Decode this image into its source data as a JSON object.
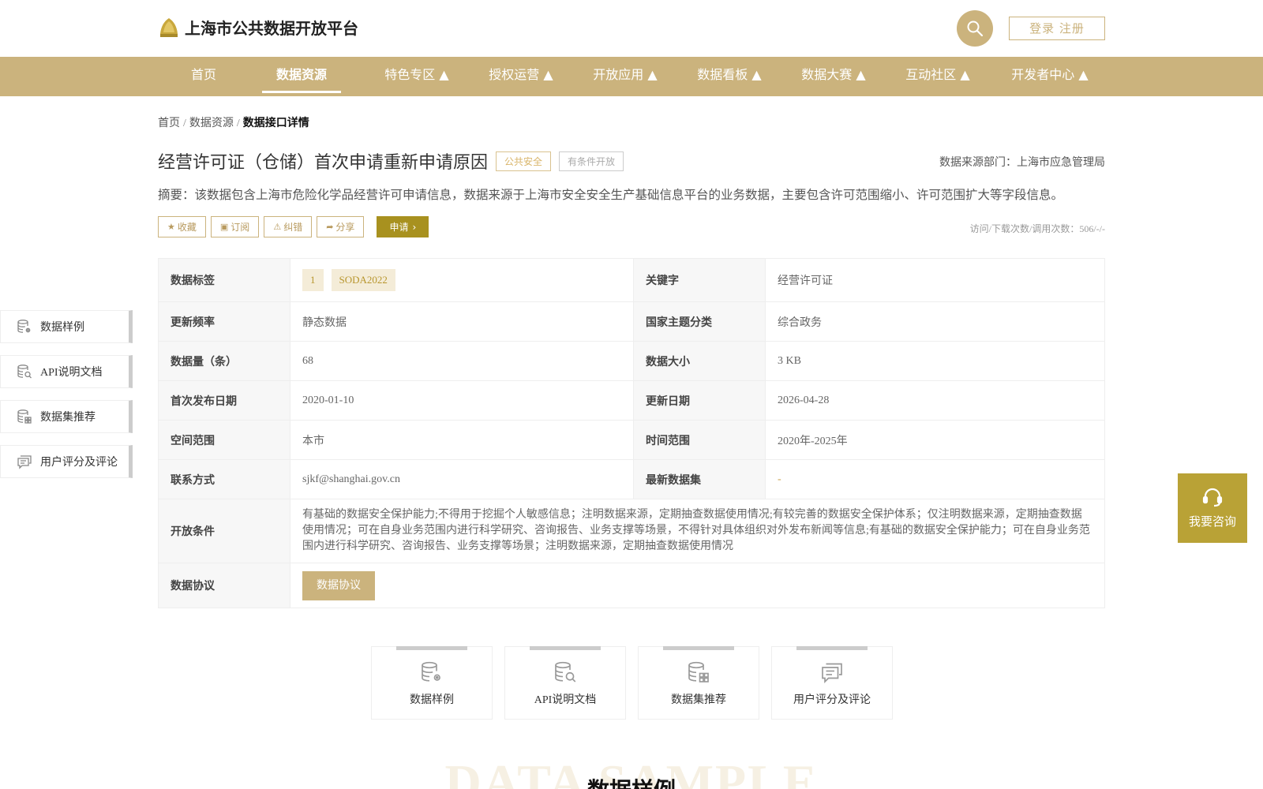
{
  "header": {
    "site_title": "上海市公共数据开放平台",
    "login_label": "登录 注册"
  },
  "nav": {
    "items": [
      {
        "label": "首页"
      },
      {
        "label": "数据资源"
      },
      {
        "label": "特色专区 ▲"
      },
      {
        "label": "授权运营 ▲"
      },
      {
        "label": "开放应用 ▲"
      },
      {
        "label": "数据看板 ▲"
      },
      {
        "label": "数据大赛 ▲"
      },
      {
        "label": "互动社区 ▲"
      },
      {
        "label": "开发者中心 ▲"
      }
    ]
  },
  "breadcrumb": {
    "items": [
      "首页",
      "数据资源",
      "数据接口详情"
    ],
    "separator": "/"
  },
  "dataset": {
    "title": "经营许可证（仓储）首次申请重新申请原因",
    "badge_category": "公共安全",
    "badge_openness": "有条件开放",
    "source_dept": "数据来源部门：上海市应急管理局",
    "summary": "摘要：该数据包含上海市危险化学品经营许可申请信息，数据来源于上海市安全安全生产基础信息平台的业务数据，主要包含许可范围缩小、许可范围扩大等字段信息。",
    "stats": "访问/下载次数/调用次数：506/-/-"
  },
  "actions": {
    "favorite": "收藏",
    "subscribe": "订阅",
    "correct": "纠错",
    "share": "分享",
    "apply": "申请"
  },
  "table": {
    "tags_label": "数据标签",
    "tags": [
      "1",
      "SODA2022"
    ],
    "keyword_label": "关键字",
    "keyword": "经营许可证",
    "freq_label": "更新频率",
    "freq": "静态数据",
    "theme_label": "国家主题分类",
    "theme": "综合政务",
    "count_label": "数据量（条）",
    "count": "68",
    "size_label": "数据大小",
    "size": "3 KB",
    "first_pub_label": "首次发布日期",
    "first_pub": "2020-01-10",
    "updated_label": "更新日期",
    "updated": "2026-04-28",
    "space_label": "空间范围",
    "space": "本市",
    "time_label": "时间范围",
    "time": "2020年-2025年",
    "contact_label": "联系方式",
    "contact": "sjkf@shanghai.gov.cn",
    "latest_label": "最新数据集",
    "latest": "-",
    "conditions_label": "开放条件",
    "conditions": "有基础的数据安全保护能力;不得用于挖掘个人敏感信息；注明数据来源，定期抽查数据使用情况;有较完善的数据安全保护体系；仅注明数据来源，定期抽查数据使用情况；可在自身业务范围内进行科学研究、咨询报告、业务支撑等场景，不得针对具体组织对外发布新闻等信息;有基础的数据安全保护能力；可在自身业务范围内进行科学研究、咨询报告、业务支撑等场景；注明数据来源，定期抽查数据使用情况",
    "protocol_label": "数据协议",
    "protocol_button": "数据协议"
  },
  "side_nav": {
    "items": [
      {
        "label": "数据样例",
        "icon": "database-gear-icon"
      },
      {
        "label": "API说明文档",
        "icon": "database-search-icon"
      },
      {
        "label": "数据集推荐",
        "icon": "database-grid-icon"
      },
      {
        "label": "用户评分及评论",
        "icon": "comment-icon"
      }
    ]
  },
  "consult": {
    "label": "我要咨询"
  },
  "bottom_tabs": {
    "items": [
      {
        "label": "数据样例"
      },
      {
        "label": "API说明文档"
      },
      {
        "label": "数据集推荐"
      },
      {
        "label": "用户评分及评论"
      }
    ]
  },
  "section": {
    "watermark": "DATA SAMPLE",
    "title": "数据样例"
  },
  "colors": {
    "brand": "#cbb37d",
    "apply": "#a8911f",
    "consult": "#b9a236"
  }
}
